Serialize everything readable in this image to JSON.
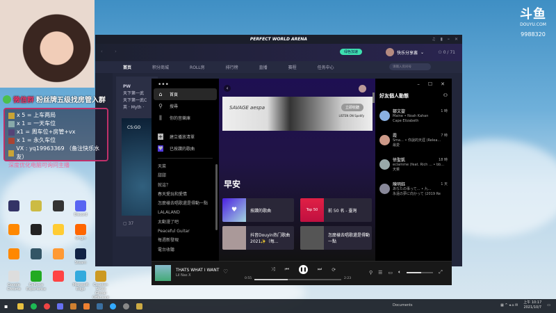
{
  "stream": {
    "logo": "斗鱼",
    "logo_sub": "DOUYU.COM",
    "room_id": "9988320",
    "banner_red": "微信群",
    "banner": "粉丝牌五级找房管入群",
    "rules": [
      "x 5 = 上车两局",
      "x 1 = 一天车位",
      "x1 = 周车位+房管+vx",
      "x 1 = 永久车位",
      "VX : yq19963369 （备注快乐水友）"
    ],
    "note": "深度优化电脑可询问主播"
  },
  "desktop_icons": [
    "",
    "",
    "",
    "Discord",
    "",
    "",
    "",
    "Origin",
    "",
    "",
    "",
    "Steam",
    "Google Chrome",
    "GeForce Experience",
    "",
    "Microsoft Edge",
    "Counter-Strike Global Offensive"
  ],
  "pwa": {
    "title": "PERFECT WORLD ARENA",
    "vip": "绿色加速",
    "username": "快乐分享酱",
    "friends_count": "0 / 71",
    "tabs": [
      "首页",
      "积分商城",
      "ROLL房",
      "排行榜",
      "直播",
      "赛程",
      "任务中心"
    ],
    "search_placeholder": "请输入房间号",
    "post": {
      "author": "PW",
      "line1": "天下第一武",
      "line2": "天下第一武C",
      "line3": "英 · Myth · ",
      "game": "CS:GO",
      "comments": "37"
    }
  },
  "spotify": {
    "nav": [
      "首頁",
      "搜尋",
      "你的音樂庫"
    ],
    "create_playlist": "建立播放清單",
    "liked_songs": "已按讚的歌曲",
    "playlists": [
      "天菜",
      "甜甜",
      "就這？",
      "春天愛玩和愛情",
      "怎麼樣去唱歌還是得動一點",
      "LALALAND",
      "太動漫了吧",
      "Peaceful Guitar",
      "每週新發現",
      "電台收聽"
    ],
    "ad": {
      "artist": "SAVAGE aespa",
      "button": "立即收聽",
      "by": "LISTEN ON Spotify"
    },
    "greeting": "早安",
    "tiles": [
      {
        "label": "按讚的歌曲",
        "art": "♥"
      },
      {
        "label": "前 50 名 - 臺灣",
        "art": "Top 50"
      },
      {
        "label": "抖音Douyin热门歌曲2021✨（每...",
        "art": ""
      },
      {
        "label": "怎麼樣去唱歌還是得動一點",
        "art": ""
      }
    ],
    "friends": {
      "title": "好友個人動態",
      "items": [
        {
          "name": "鄒文鋆",
          "time": "1 時",
          "track": "Maine • Noah Kahan",
          "context": "Cape Elizabeth"
        },
        {
          "name": "霞",
          "time": "7 時",
          "track": "Sma... • 你說的天涯 (Relea...",
          "context": "最愛"
        },
        {
          "name": "徐聖凱",
          "time": "18 時",
          "track": "eclamme (feat. Rich ... • bb...",
          "context": "天菜"
        },
        {
          "name": "陳明鈺",
          "time": "1 天",
          "track": "あなたの事って... • 九...",
          "context": "永遠の夢に向かって (2019 Re"
        }
      ]
    },
    "player": {
      "title": "THATS WHAT I WANT",
      "artist": "Lil Nas X",
      "elapsed": "0:55",
      "duration": "2:23",
      "progress": 0.38,
      "volume": 0.55
    }
  },
  "taskbar": {
    "folder": "Documents",
    "time": "上午 10:17",
    "date": "2021/10/7"
  }
}
